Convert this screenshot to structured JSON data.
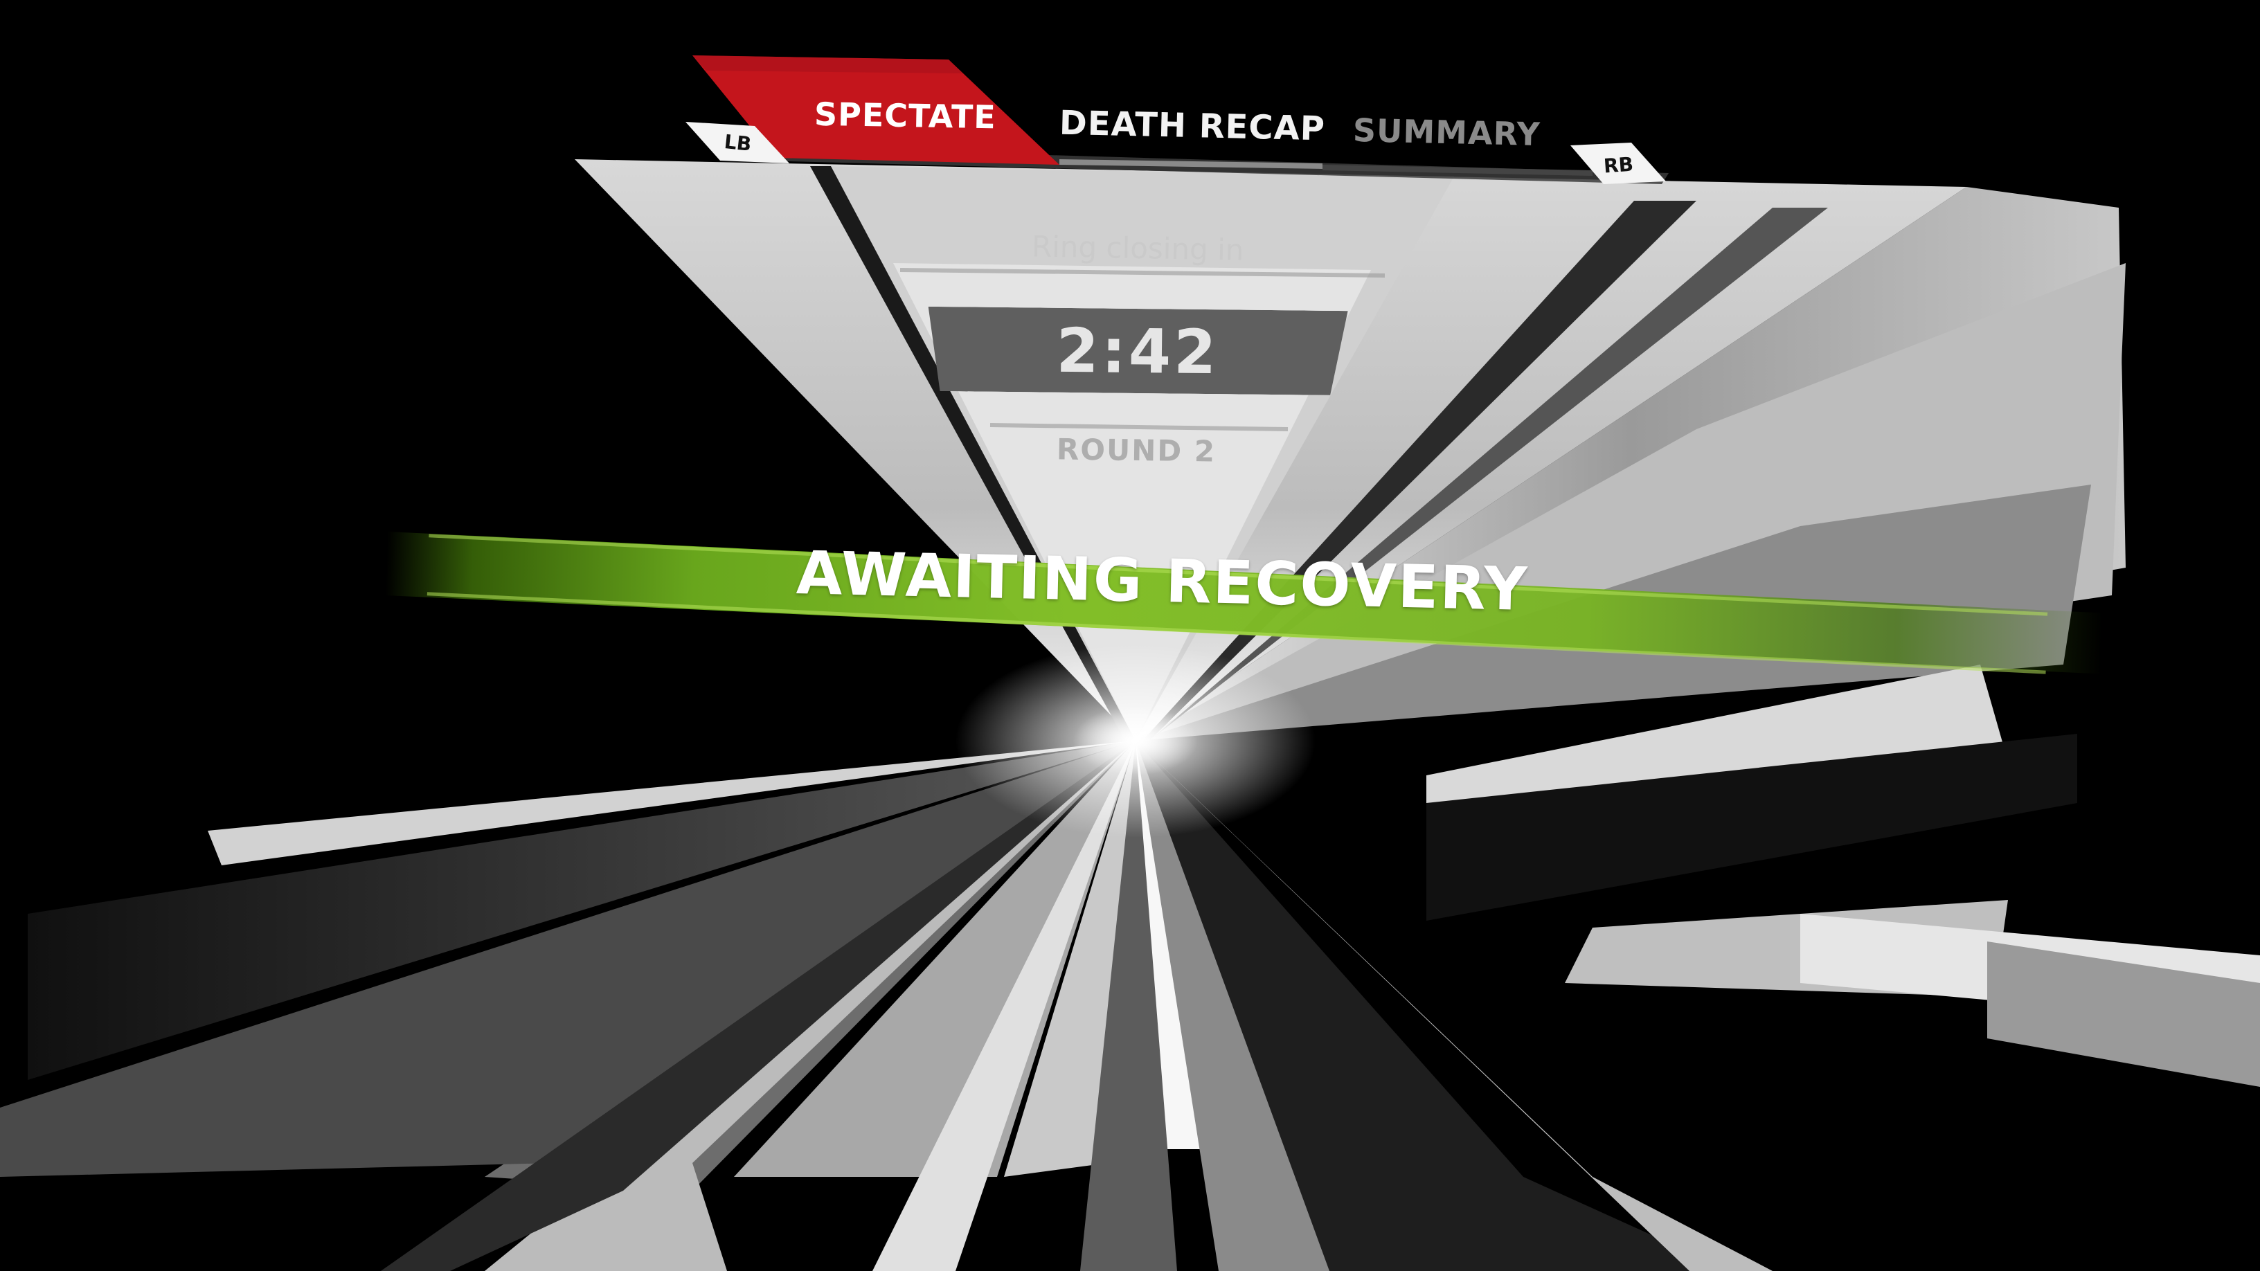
{
  "tabs": {
    "left_bumper": "LB",
    "right_bumper": "RB",
    "items": [
      {
        "label": "SPECTATE",
        "active": true
      },
      {
        "label": "DEATH RECAP",
        "active": false
      },
      {
        "label": "SUMMARY",
        "active": false
      }
    ]
  },
  "timer_panel": {
    "ring_status": "Ring closing in",
    "time": "2:42",
    "round": "ROUND 2"
  },
  "status_banner": {
    "text": "AWAITING RECOVERY"
  },
  "colors": {
    "active_tab": "#c4151c",
    "banner_green": "#82be28",
    "background": "#000000"
  }
}
